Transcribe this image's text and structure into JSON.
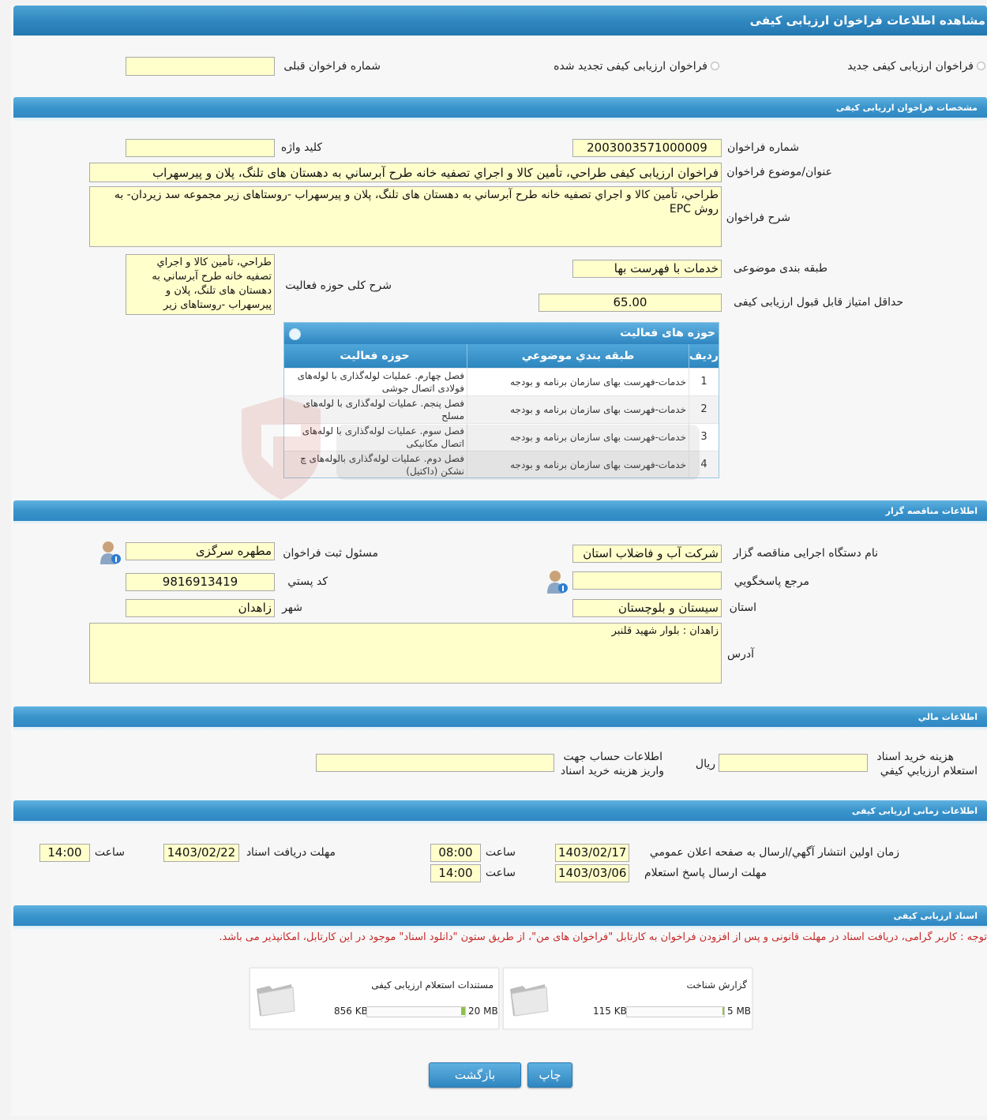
{
  "page": {
    "title": "مشاهده اطلاعات فراخوان ارزيابی کيفی"
  },
  "type_selection": {
    "option_new": "فراخوان ارزيابی کيفی جديد",
    "option_renewed": "فراخوان ارزيابی کيفی تجديد شده",
    "previous_number_label": "شماره فراخوان قبلی",
    "previous_number_value": ""
  },
  "sections": {
    "specs": "مشخصات فراخوان ارزيابی کيفی",
    "organizer": "اطلاعات مناقصه گزار",
    "financial": "اطلاعات مالي",
    "timing": "اطلاعات زمانی ارزيابی کيفی",
    "documents": "اسناد ارزيابی کيفی"
  },
  "specs": {
    "number_label": "شماره فراخوان",
    "number_value": "2003003571000009",
    "keyword_label": "کليد واژه",
    "keyword_value": "",
    "subject_label": "عنوان/موضوع فراخوان",
    "subject_value": "فراخوان ارزيابی کيفی طراحي، تأمين کالا و اجراي تصفيه خانه طرح آبرساني به دهستان های تلنگ، پلان و پيرسهراب",
    "description_label": "شرح فراخوان",
    "description_value": "طراحي، تأمين کالا و اجراي تصفيه خانه طرح آبرساني به دهستان های تلنگ، پلان و پيرسهراب -روستاهای زير مجموعه سد زيردان- به روش  EPC",
    "category_label": "طبقه بندی موضوعی",
    "category_value": "خدمات با فهرست بها",
    "scope_label": "شرح کلی حوزه فعاليت",
    "scope_value": "طراحي، تأمين کالا و اجراي تصفيه خانه طرح آبرساني به دهستان های تلنگ، پلان و پيرسهراب -روستاهای زير",
    "min_score_label": "حداقل امتياز قابل قبول ارزيابی کيفی",
    "min_score_value": "65.00"
  },
  "activity_grid": {
    "title": "حوزه های فعاليت",
    "col_row": "رديف",
    "col_category": "طبقه بندي موضوعي",
    "col_activity": "حوزه فعاليت",
    "rows": [
      {
        "n": "1",
        "category": "خدمات-فهرست بهای سازمان برنامه و بودجه",
        "activity": "فصل چهارم. عمليات لوله‌گذاری با لوله‌های فولادی اتصال جوشی"
      },
      {
        "n": "2",
        "category": "خدمات-فهرست بهای سازمان برنامه و بودجه",
        "activity": "فصل پنجم. عمليات لوله‌گذاری با لوله‌های مسلح"
      },
      {
        "n": "3",
        "category": "خدمات-فهرست بهای سازمان برنامه و بودجه",
        "activity": "فصل سوم. عمليات لوله‌گذاری با لوله‌های اتصال مکانيکی"
      },
      {
        "n": "4",
        "category": "خدمات-فهرست بهای سازمان برنامه و بودجه",
        "activity": "فصل دوم. عمليات لوله‌گذاری بالوله‌های چ نشکن (داکتيل)"
      }
    ]
  },
  "organizer": {
    "agency_label": "نام دستگاه اجرايی مناقصه گزار",
    "agency_value": "شرکت آب و فاضلاب استان",
    "registrar_label": "مسئول ثبت فراخوان",
    "registrar_value": "مطهره سرگزی",
    "contact_label": "مرجع پاسخگويي",
    "contact_value": "",
    "postal_label": "کد پستي",
    "postal_value": "9816913419",
    "province_label": "استان",
    "province_value": "سيستان و بلوچستان",
    "city_label": "شهر",
    "city_value": "زاهدان",
    "address_label": "آدرس",
    "address_value": "زاهدان : بلوار شهيد قلنبر"
  },
  "financial": {
    "fee_label_line1": "هزينه خريد اسناد",
    "fee_label_line2": "استعلام ارزيابي کيفي",
    "fee_value": "",
    "currency": "ريال",
    "account_label_line1": "اطلاعات حساب جهت",
    "account_label_line2": "واريز هزينه خريد اسناد",
    "account_value": ""
  },
  "timing": {
    "publish_label": "زمان اولين انتشار آگهي/ارسال به صفحه اعلان عمومي",
    "publish_date": "1403/02/17",
    "publish_time": "08:00",
    "doc_deadline_label": "مهلت دريافت اسناد",
    "doc_deadline_date": "1403/02/22",
    "doc_deadline_time": "14:00",
    "response_label": "مهلت ارسال پاسخ استعلام",
    "response_date": "1403/03/06",
    "response_time": "14:00",
    "time_label": "ساعت"
  },
  "documents": {
    "notice": "توجه : کاربر گرامی، دريافت اسناد در مهلت قانونی و پس از افزودن فراخوان به کارتابل \"فراخوان های من\"، از طريق ستون \"دانلود اسناد\" موجود در اين کارتابل، امکانپذير می باشد.",
    "files": [
      {
        "name": "گزارش شناخت",
        "size": "115 KB",
        "max": "5 MB",
        "fill_fraction": 0.02
      },
      {
        "name": "مستندات استعلام ارزيابی کيفی",
        "size": "856 KB",
        "max": "20 MB",
        "fill_fraction": 0.04
      }
    ]
  },
  "buttons": {
    "print": "چاپ",
    "back": "بازگشت"
  },
  "colors": {
    "header_blue": "#2f86bf",
    "field_yellow": "#ffffcc",
    "notice_red": "#c62828"
  }
}
